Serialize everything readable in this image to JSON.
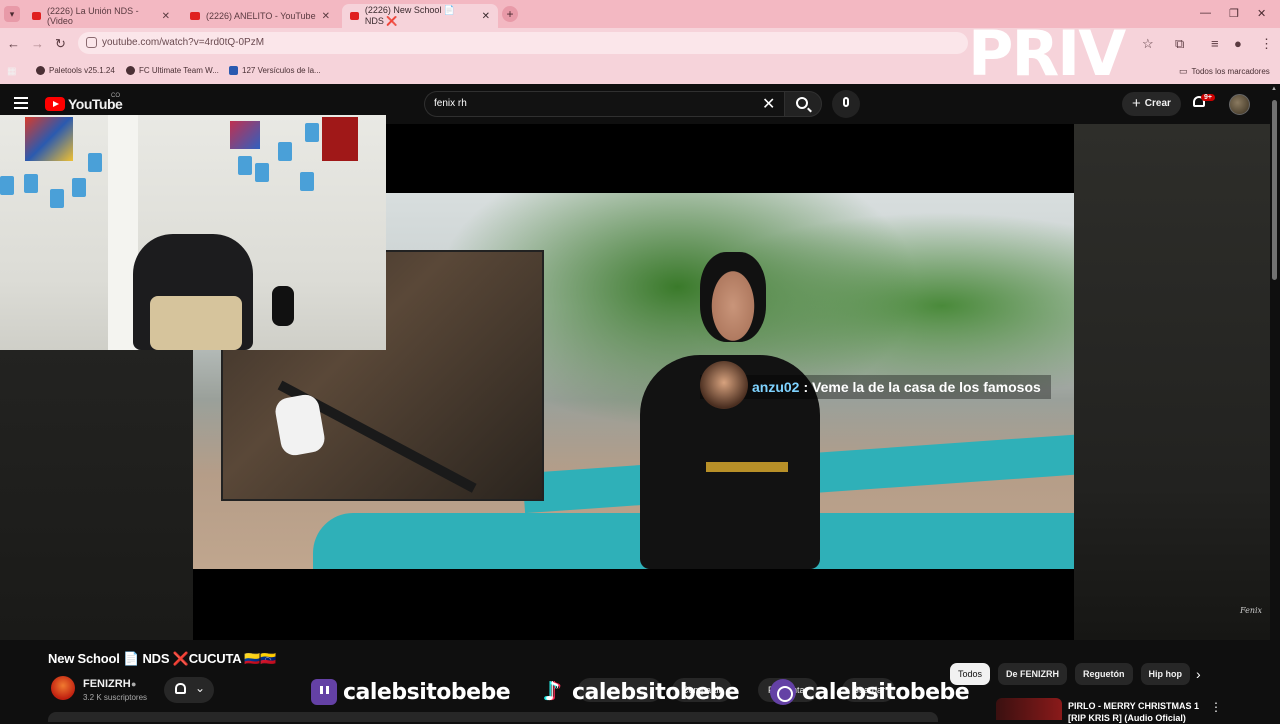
{
  "browser": {
    "tabs": [
      {
        "title": "(2226) La Unión NDS - (Video"
      },
      {
        "title": "(2226) ANELITO - YouTube"
      },
      {
        "title": "(2226) New School 📄 NDS ❌"
      }
    ],
    "url": "youtube.com/watch?v=4rd0tQ-0PzM",
    "bookmarks": [
      {
        "label": "Paletools v25.1.24"
      },
      {
        "label": "FC Ultimate Team W..."
      },
      {
        "label": "127 Versículos de la..."
      }
    ],
    "all_bookmarks": "Todos los marcadores"
  },
  "overlay_logo": "PRIV",
  "youtube": {
    "logo_text": "YouTube",
    "country_code": "CO",
    "search_query": "fenix rh",
    "create_label": "Crear",
    "notifications_badge": "9+"
  },
  "chat": {
    "user": "anzu02",
    "message": ": Veme la de la casa de los famosos"
  },
  "watermark": "Fenix",
  "video": {
    "title": "New School 📄 NDS ❌CUCUTA 🇨🇴🇻🇪",
    "channel": "FENIZRH",
    "subscribers": "3.2 K suscriptores",
    "actions": [
      "Compartir",
      "Preguntar",
      "Guardar"
    ]
  },
  "chips": [
    "Todos",
    "De FENIZRH",
    "Reguetón",
    "Hip hop"
  ],
  "recommendation": {
    "title": "PIRLO - MERRY CHRISTMAS 1 [RIP KRIS R] (Audio Oficial)"
  },
  "socials": [
    "calebsitobebe",
    "calebsitobebe",
    "calebsitobebe"
  ],
  "colors": {
    "browser_frame": "#f3b8c2",
    "youtube_bg": "#0f0f0f",
    "youtube_red": "#ff0000",
    "chat_user": "#7fd3ff",
    "social_purple": "#6441a5"
  }
}
